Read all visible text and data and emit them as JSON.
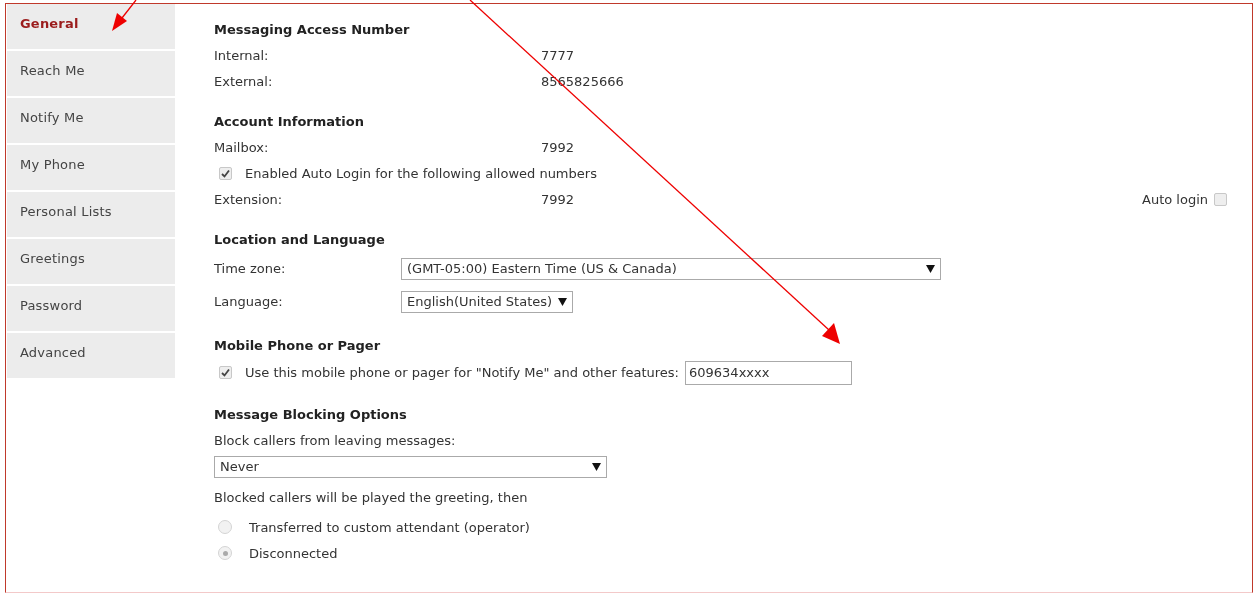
{
  "sidebar": {
    "items": [
      {
        "label": "General",
        "selected": true
      },
      {
        "label": "Reach Me",
        "selected": false
      },
      {
        "label": "Notify Me",
        "selected": false
      },
      {
        "label": "My Phone",
        "selected": false
      },
      {
        "label": "Personal Lists",
        "selected": false
      },
      {
        "label": "Greetings",
        "selected": false
      },
      {
        "label": "Password",
        "selected": false
      },
      {
        "label": "Advanced",
        "selected": false
      }
    ]
  },
  "sections": [
    {
      "title": "Messaging Access Number",
      "rows": [
        {
          "kind": "pair",
          "label": "Internal:",
          "value": "7777"
        },
        {
          "kind": "pair",
          "label": "External:",
          "value": "8565825666"
        }
      ]
    },
    {
      "title": "Account Information",
      "rows": [
        {
          "kind": "pair",
          "label": "Mailbox:",
          "value": "7992"
        },
        {
          "kind": "checkbox",
          "label": "Enabled Auto Login for the following allowed numbers",
          "checked": true
        },
        {
          "kind": "pair_check",
          "label": "Extension:",
          "value": "7992",
          "check_label": "Auto login",
          "checked": false
        }
      ]
    },
    {
      "title": "Location and Language",
      "rows": [
        {
          "kind": "select",
          "label": "Time zone:",
          "value": "(GMT-05:00) Eastern Time (US & Canada)",
          "wide": true
        },
        {
          "kind": "select",
          "label": "Language:",
          "value": "English(United States)",
          "wide": false
        }
      ]
    },
    {
      "title": "Mobile Phone or Pager",
      "rows": [
        {
          "kind": "checkbox_input",
          "label": "Use this mobile phone or pager for \"Notify Me\" and other features:",
          "checked": true,
          "value": "609634xxxx"
        }
      ]
    },
    {
      "title": "Message Blocking Options",
      "rows": [
        {
          "kind": "text",
          "label": "Block callers from leaving messages:"
        },
        {
          "kind": "select_block",
          "value": "Never"
        },
        {
          "kind": "text",
          "label": "Blocked callers will be played the greeting, then"
        },
        {
          "kind": "radio",
          "label": "Transferred to custom attendant (operator)",
          "selected": false
        },
        {
          "kind": "radio",
          "label": "Disconnected",
          "selected": true
        }
      ]
    }
  ]
}
